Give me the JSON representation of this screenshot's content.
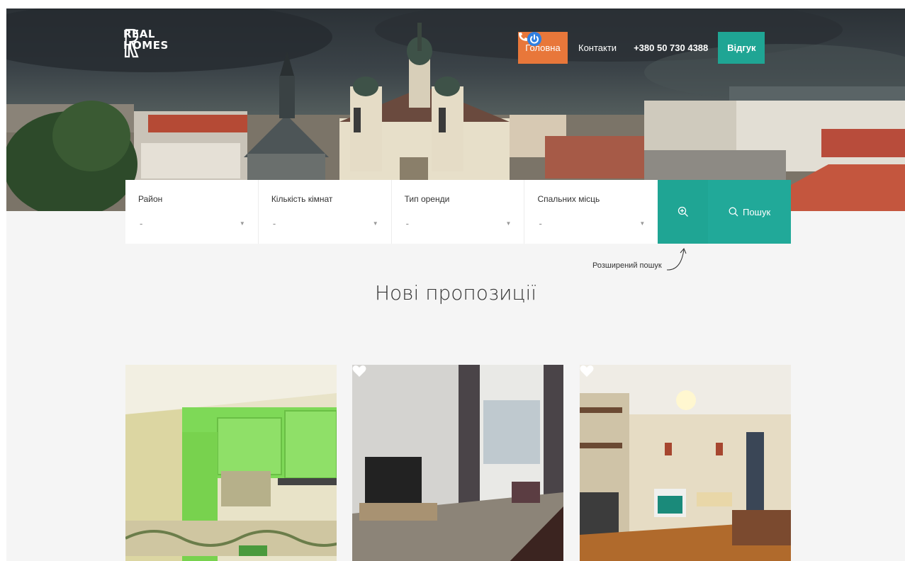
{
  "brand": {
    "line1": "REAL",
    "line2": "HOMES"
  },
  "nav": {
    "home": "Головна",
    "contacts": "Контакти",
    "phone": "+380 50 730 4388",
    "feedback": "Відгук"
  },
  "search": {
    "fields": [
      {
        "label": "Район",
        "value": "-"
      },
      {
        "label": "Кількість кімнат",
        "value": "-"
      },
      {
        "label": "Тип оренди",
        "value": "-"
      },
      {
        "label": "Спальних місць",
        "value": "-"
      }
    ],
    "submit": "Пошук",
    "advanced": "Розширений пошук"
  },
  "section_title": "Нові пропозиції",
  "colors": {
    "accent_orange": "#e8773a",
    "accent_teal": "#1fa594"
  },
  "icons": [
    "logo-mark-icon",
    "phone-icon",
    "power-icon",
    "zoom-in-icon",
    "search-icon",
    "heart-icon"
  ]
}
